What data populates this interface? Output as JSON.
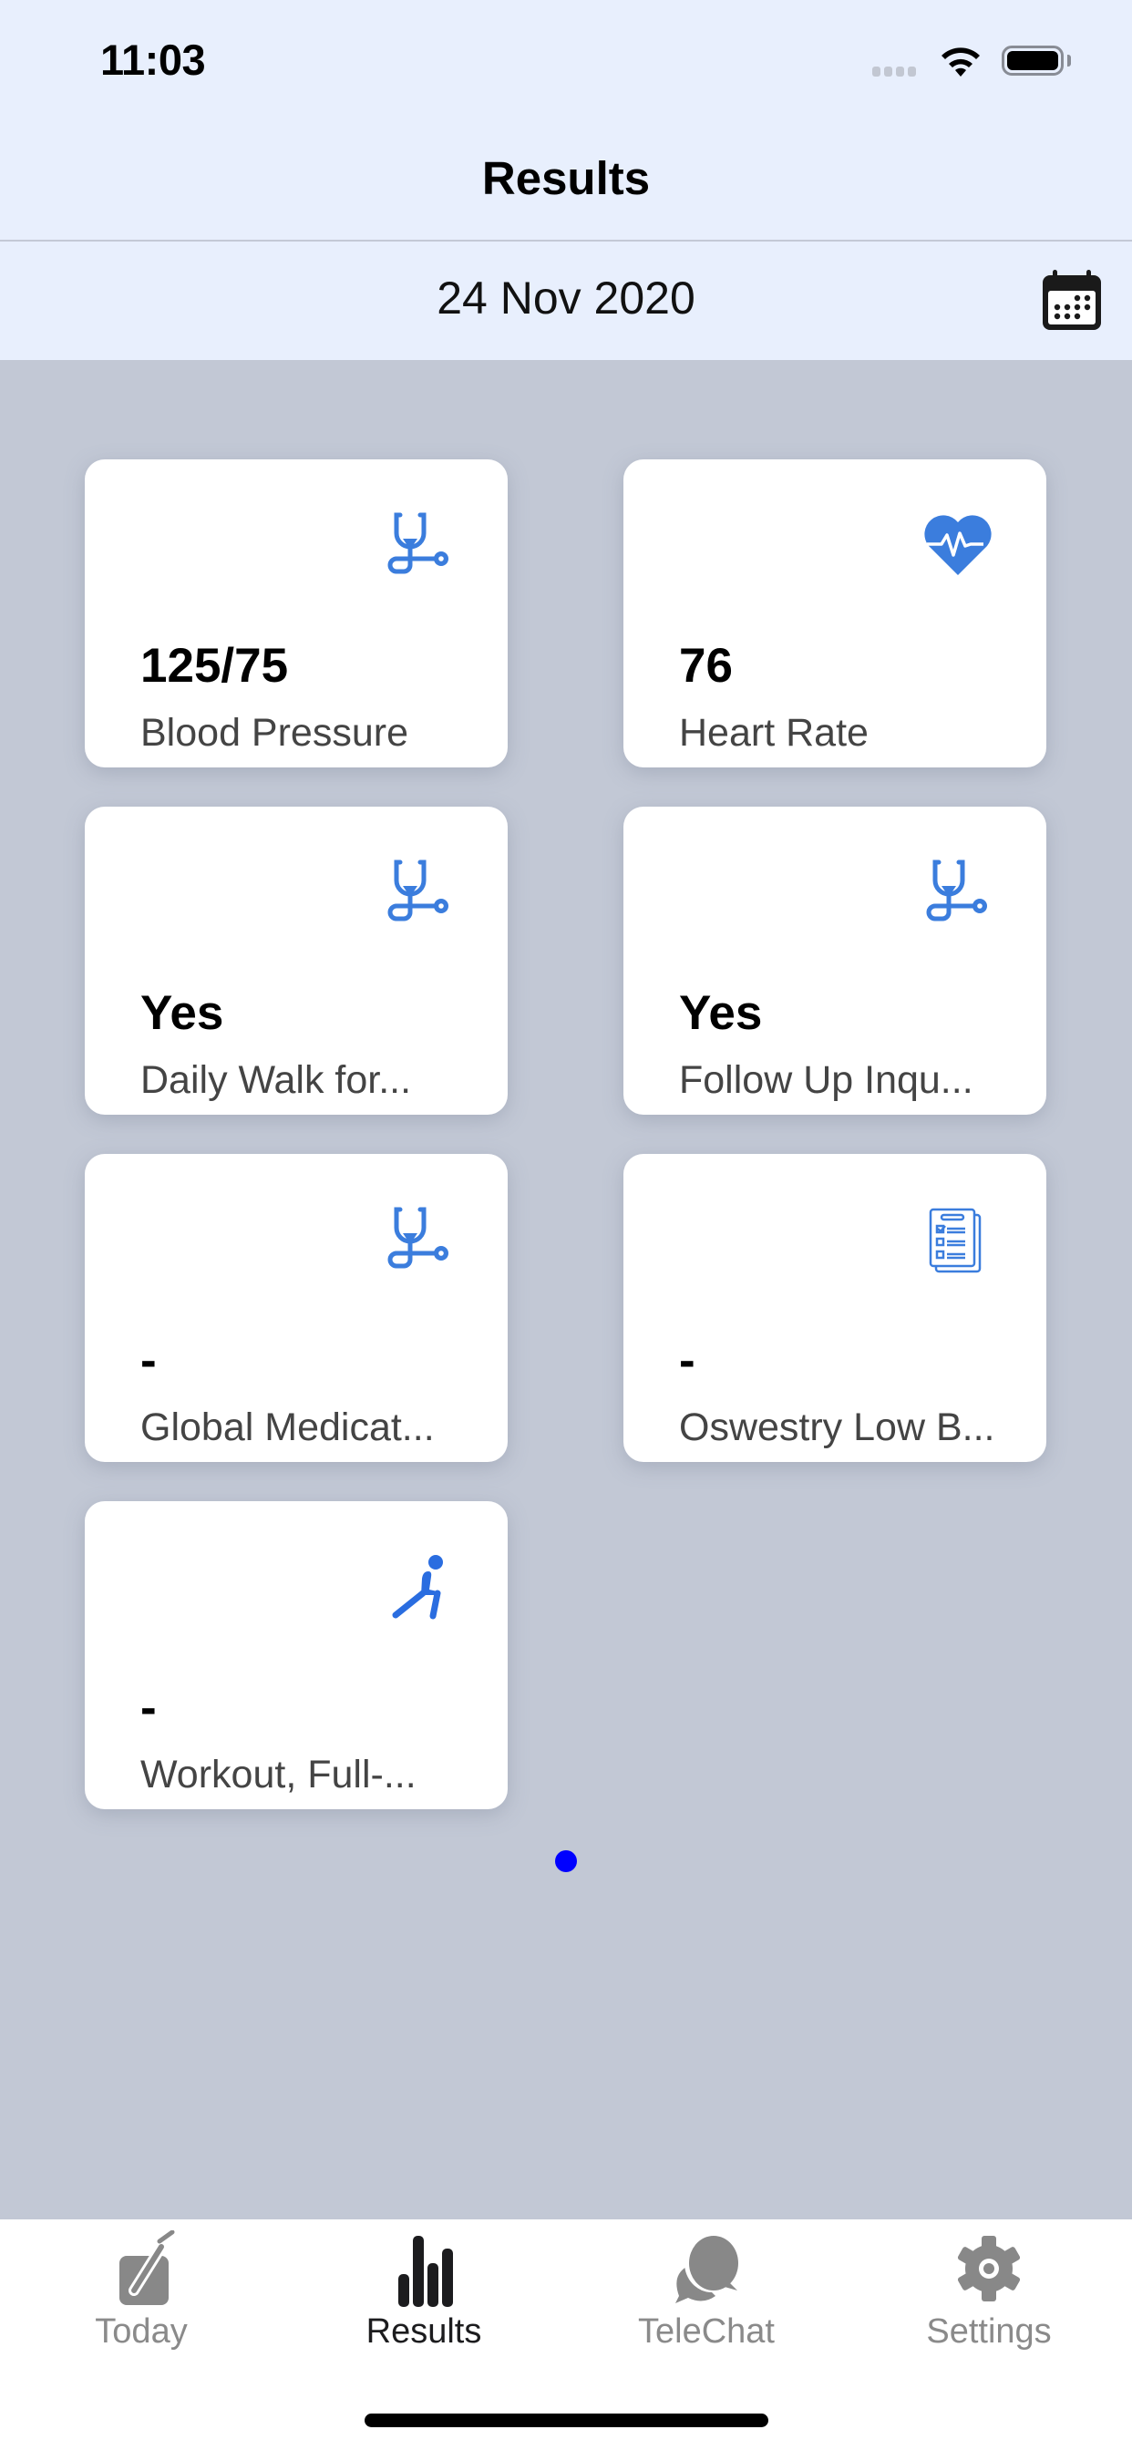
{
  "status_bar": {
    "time": "11:03",
    "icons": [
      "signal-icon",
      "wifi-icon",
      "battery-icon"
    ]
  },
  "header": {
    "title": "Results"
  },
  "date_bar": {
    "date": "24 Nov 2020",
    "calendar_icon": "calendar-icon"
  },
  "cards": [
    {
      "value": "125/75",
      "label": "Blood Pressure",
      "icon": "stethoscope-icon"
    },
    {
      "value": "76",
      "label": "Heart Rate",
      "icon": "heart-pulse-icon"
    },
    {
      "value": "Yes",
      "label": "Daily Walk for...",
      "icon": "stethoscope-icon"
    },
    {
      "value": "Yes",
      "label": "Follow Up Inqu...",
      "icon": "stethoscope-icon"
    },
    {
      "value": "-",
      "label": "Global Medicat...",
      "icon": "stethoscope-icon"
    },
    {
      "value": "-",
      "label": "Oswestry Low B...",
      "icon": "checklist-icon"
    },
    {
      "value": "-",
      "label": "Workout, Full-...",
      "icon": "exercise-icon"
    }
  ],
  "pager": {
    "pages": 1,
    "current": 1
  },
  "tab_bar": {
    "tabs": [
      {
        "label": "Today",
        "icon": "edit-icon",
        "active": false
      },
      {
        "label": "Results",
        "icon": "bar-chart-icon",
        "active": true
      },
      {
        "label": "TeleChat",
        "icon": "chat-bubbles-icon",
        "active": false
      },
      {
        "label": "Settings",
        "icon": "gear-icon",
        "active": false
      }
    ]
  },
  "colors": {
    "accent_icon": "#3b7ddd",
    "header_bg": "#e8effd",
    "content_bg": "#c2c8d5",
    "pager_dot": "#0000ff",
    "tab_active": "#1c1c1e",
    "tab_inactive": "#8a8a8a"
  }
}
